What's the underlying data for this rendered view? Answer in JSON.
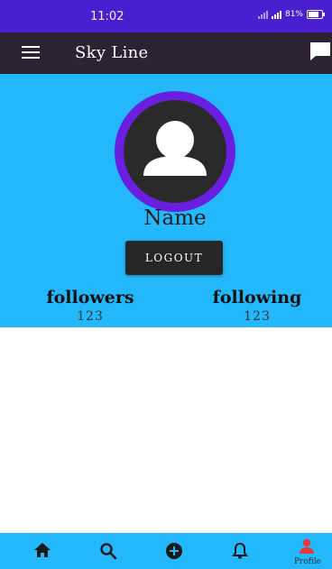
{
  "status_bar": {
    "time": "11:02",
    "battery_text": "81%"
  },
  "app_bar": {
    "title": "Sky Line",
    "menu_icon": "hamburger-menu-icon",
    "chat_icon": "chat-icon"
  },
  "profile": {
    "avatar_icon": "user-avatar-icon",
    "name": "Name",
    "logout_label": "LOGOUT",
    "followers_label": "followers",
    "followers_count": "123",
    "following_label": "following",
    "following_count": "123"
  },
  "bottom_nav": {
    "items": [
      {
        "icon": "home-icon"
      },
      {
        "icon": "search-icon"
      },
      {
        "icon": "add-circle-icon"
      },
      {
        "icon": "bell-icon"
      },
      {
        "icon": "profile-icon",
        "label": "Profile",
        "active": true
      }
    ]
  },
  "colors": {
    "status_bar": "#4a1fd0",
    "app_bar": "#2b2233",
    "accent_blue": "#22b8fb",
    "avatar_ring": "#6a1fe0",
    "active_nav": "#e23a3a"
  }
}
